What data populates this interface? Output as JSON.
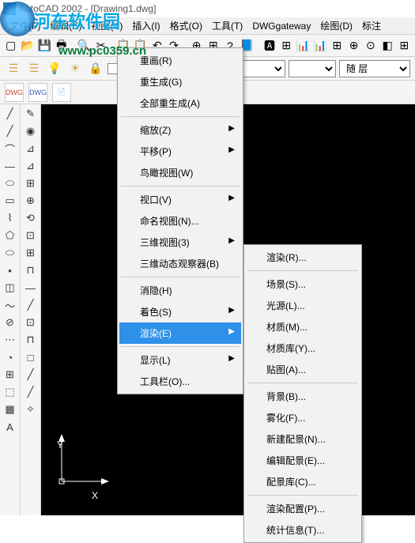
{
  "title": "AutoCAD 2002 - [Drawing1.dwg]",
  "watermark": {
    "text": "河东软件园",
    "url": "www.pc0359.cn"
  },
  "menubar": [
    "文件(F)",
    "编辑(E)",
    "视图(V)",
    "插入(I)",
    "格式(O)",
    "工具(T)",
    "DWGgateway",
    "绘图(D)",
    "标注"
  ],
  "layer_combo_label": "随 层",
  "dwg_labels": [
    "DWG",
    "DWG"
  ],
  "view_menu": {
    "items": [
      {
        "label": "重画(R)"
      },
      {
        "label": "重生成(G)"
      },
      {
        "label": "全部重生成(A)"
      },
      {
        "sep": true
      },
      {
        "label": "缩放(Z)",
        "sub": true
      },
      {
        "label": "平移(P)",
        "sub": true
      },
      {
        "label": "鸟瞰视图(W)"
      },
      {
        "sep": true
      },
      {
        "label": "视口(V)",
        "sub": true
      },
      {
        "label": "命名视图(N)..."
      },
      {
        "label": "三维视图(3)",
        "sub": true
      },
      {
        "label": "三维动态观察器(B)"
      },
      {
        "sep": true
      },
      {
        "label": "消隐(H)"
      },
      {
        "label": "着色(S)",
        "sub": true
      },
      {
        "label": "渲染(E)",
        "sub": true,
        "hl": true
      },
      {
        "sep": true
      },
      {
        "label": "显示(L)",
        "sub": true
      },
      {
        "label": "工具栏(O)..."
      }
    ]
  },
  "render_submenu": {
    "items": [
      {
        "label": "渲染(R)..."
      },
      {
        "sep": true
      },
      {
        "label": "场景(S)..."
      },
      {
        "label": "光源(L)..."
      },
      {
        "label": "材质(M)..."
      },
      {
        "label": "材质库(Y)..."
      },
      {
        "label": "贴图(A)..."
      },
      {
        "sep": true
      },
      {
        "label": "背景(B)..."
      },
      {
        "label": "雾化(F)..."
      },
      {
        "label": "新建配景(N)..."
      },
      {
        "label": "编辑配景(E)..."
      },
      {
        "label": "配景库(C)..."
      },
      {
        "sep": true
      },
      {
        "label": "渲染配置(P)..."
      },
      {
        "label": "统计信息(T)..."
      }
    ]
  },
  "ucs": {
    "y": "Y",
    "x": "X"
  },
  "side1_icons": [
    "╱",
    "╱",
    "⌒",
    "―",
    "⬭",
    "▭",
    "⌇",
    "⬠",
    "⬭",
    "•",
    "◫",
    "～",
    "⊘",
    "⋯",
    "◔",
    "⊞",
    "⬚",
    "▦",
    "A"
  ],
  "side2_icons": [
    "✎",
    "◉",
    "⊿",
    "⊿",
    "⊞",
    "⊕",
    "⟲",
    "⊡",
    "⊞",
    "⊓",
    "—",
    "╱",
    "⊡",
    "⊓",
    "□",
    "╱",
    "╱",
    "✧"
  ],
  "tb1_icons": [
    "▢",
    "📂",
    "💾",
    "🖶",
    "🔍",
    "✂",
    "📋",
    "📋",
    "↶",
    "↷",
    "⊕",
    "⊞",
    "?",
    "📘",
    "🅰",
    "⊞",
    "📊",
    "📊",
    "⊞",
    "⊕",
    "⊙",
    "◧",
    "⊞"
  ]
}
